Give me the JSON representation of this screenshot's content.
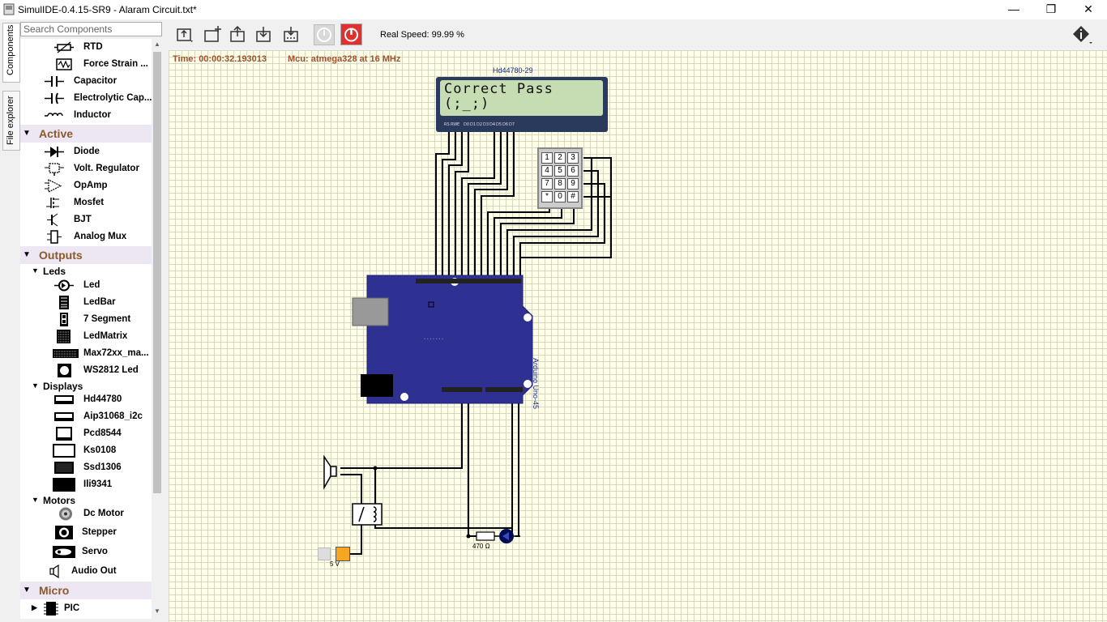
{
  "window": {
    "title": "SimulIDE-0.4.15-SR9  -  Alaram Circuit.txt*",
    "minimize": "—",
    "maximize": "❐",
    "close": "✕"
  },
  "side_tabs": {
    "components": "Components",
    "file_explorer": "File explorer"
  },
  "search": {
    "placeholder": "Search Components"
  },
  "tree": {
    "passive_tail": [
      {
        "label": "RTD",
        "icon": "rtd-icon"
      },
      {
        "label": "Force Strain ...",
        "icon": "force-strain-icon"
      },
      {
        "label": "Capacitor",
        "icon": "capacitor-icon"
      },
      {
        "label": "Electrolytic Cap...",
        "icon": "electrolytic-cap-icon"
      },
      {
        "label": "Inductor",
        "icon": "inductor-icon"
      }
    ],
    "active": {
      "label": "Active",
      "items": [
        {
          "label": "Diode",
          "icon": "diode-icon"
        },
        {
          "label": "Volt. Regulator",
          "icon": "volt-regulator-icon"
        },
        {
          "label": "OpAmp",
          "icon": "opamp-icon"
        },
        {
          "label": "Mosfet",
          "icon": "mosfet-icon"
        },
        {
          "label": "BJT",
          "icon": "bjt-icon"
        },
        {
          "label": "Analog Mux",
          "icon": "analog-mux-icon"
        }
      ]
    },
    "outputs": {
      "label": "Outputs",
      "leds": {
        "label": "Leds",
        "items": [
          {
            "label": "Led",
            "icon": "led-icon"
          },
          {
            "label": "LedBar",
            "icon": "ledbar-icon"
          },
          {
            "label": "7 Segment",
            "icon": "seven-segment-icon"
          },
          {
            "label": "LedMatrix",
            "icon": "ledmatrix-icon"
          },
          {
            "label": "Max72xx_ma...",
            "icon": "max72xx-icon"
          },
          {
            "label": "WS2812 Led",
            "icon": "ws2812-icon"
          }
        ]
      },
      "displays": {
        "label": "Displays",
        "items": [
          {
            "label": "Hd44780",
            "icon": "hd44780-icon"
          },
          {
            "label": "Aip31068_i2c",
            "icon": "aip31068-icon"
          },
          {
            "label": "Pcd8544",
            "icon": "pcd8544-icon"
          },
          {
            "label": "Ks0108",
            "icon": "ks0108-icon"
          },
          {
            "label": "Ssd1306",
            "icon": "ssd1306-icon"
          },
          {
            "label": "Ili9341",
            "icon": "ili9341-icon"
          }
        ]
      },
      "motors": {
        "label": "Motors",
        "items": [
          {
            "label": "Dc Motor",
            "icon": "dc-motor-icon"
          },
          {
            "label": "Stepper",
            "icon": "stepper-icon"
          },
          {
            "label": "Servo",
            "icon": "servo-icon"
          }
        ]
      },
      "audio_out": {
        "label": "Audio Out",
        "icon": "speaker-icon"
      }
    },
    "micro": {
      "label": "Micro",
      "items": [
        {
          "label": "PIC",
          "icon": "pic-chip-icon"
        }
      ]
    }
  },
  "toolbar": {
    "real_speed": "Real Speed: 99.99 %"
  },
  "canvas": {
    "time": "Time: 00:00:32.193013",
    "mcu": "Mcu: atmega328 at 16 MHz",
    "lcd": {
      "id": "Hd44780-29",
      "line1": "Correct Pass",
      "line2": "(;_;)"
    },
    "keypad": [
      "1",
      "2",
      "3",
      "4",
      "5",
      "6",
      "7",
      "8",
      "9",
      "*",
      "0",
      "#"
    ],
    "arduino_label": "Arduino Uno-45",
    "resistor_label": "470 Ω",
    "supply_label": "5 V"
  },
  "colors": {
    "board": "#2e3192",
    "lcd_screen": "#c6dcb3",
    "canvas_bg": "#ffffe8",
    "category_text": "#8a5a2a",
    "stop_button": "#e03030"
  }
}
